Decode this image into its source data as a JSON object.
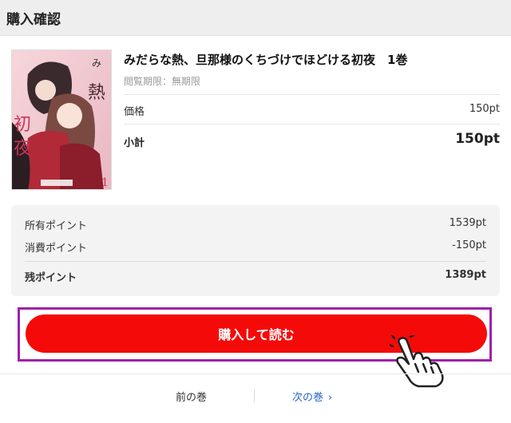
{
  "header": {
    "title": "購入確認"
  },
  "item": {
    "title": "みだらな熱、旦那様のくちづけでほどける初夜　1巻",
    "limit": "閲覧期限：無期限",
    "price_label": "価格",
    "price_value": "150pt",
    "subtotal_label": "小計",
    "subtotal_value": "150pt",
    "cover": {
      "title_text": "みだらな熱、旦那様のくちづけでほどける初夜",
      "volume": "1"
    }
  },
  "points": {
    "owned_label": "所有ポイント",
    "owned_value": "1539pt",
    "consumed_label": "消費ポイント",
    "consumed_value": "-150pt",
    "remaining_label": "残ポイント",
    "remaining_value": "1389pt"
  },
  "buy_button": {
    "label": "購入して読む"
  },
  "nav": {
    "prev_label": "前の巻",
    "next_label": "次の巻",
    "next_icon": "chevron-right-icon"
  },
  "colors": {
    "accent_red": "#f50a0a",
    "highlight_purple": "#a020a8",
    "link_blue": "#2a66c8"
  }
}
